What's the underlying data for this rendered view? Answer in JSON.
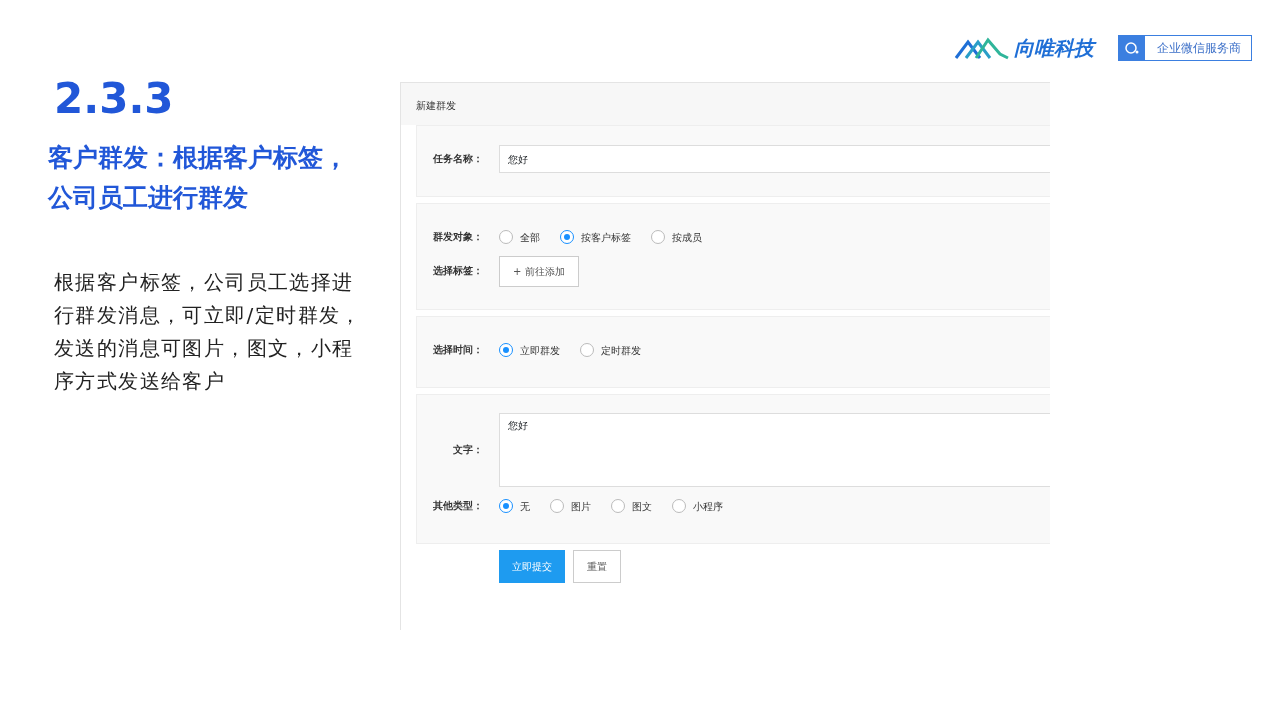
{
  "header": {
    "brand": "向唯科技",
    "badge": "企业微信服务商"
  },
  "slide": {
    "number": "2.3.3",
    "title": "客户群发：根据客户标签，公司员工进行群发",
    "description": "根据客户标签，公司员工选择进行群发消息，可立即/定时群发，发送的消息可图片，图文，小程序方式发送给客户"
  },
  "form": {
    "title": "新建群发",
    "sections": [
      {
        "rows": [
          {
            "kind": "input",
            "label": "任务名称：",
            "value": "您好"
          }
        ]
      },
      {
        "rows": [
          {
            "kind": "radio",
            "label": "群发对象：",
            "options": [
              {
                "label": "全部",
                "selected": false
              },
              {
                "label": "按客户标签",
                "selected": true
              },
              {
                "label": "按成员",
                "selected": false
              }
            ]
          },
          {
            "kind": "button",
            "label": "选择标签：",
            "button": "+ 前往添加"
          }
        ]
      },
      {
        "rows": [
          {
            "kind": "radio",
            "label": "选择时间：",
            "options": [
              {
                "label": "立即群发",
                "selected": true
              },
              {
                "label": "定时群发",
                "selected": false
              }
            ]
          }
        ]
      },
      {
        "rows": [
          {
            "kind": "textarea",
            "label": "文字：",
            "value": "您好"
          },
          {
            "kind": "radio",
            "label": "其他类型：",
            "options": [
              {
                "label": "无",
                "selected": true
              },
              {
                "label": "图片",
                "selected": false
              },
              {
                "label": "图文",
                "selected": false
              },
              {
                "label": "小程序",
                "selected": false
              }
            ]
          }
        ]
      }
    ],
    "submit": "立即提交",
    "reset": "重置"
  }
}
